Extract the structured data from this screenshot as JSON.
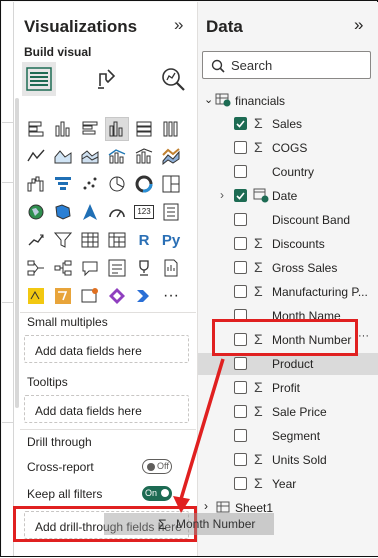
{
  "visualizations": {
    "title": "Visualizations",
    "collapse_icon": "»",
    "build_visual_label": "Build visual",
    "sections": {
      "small_multiples": "Small multiples",
      "tooltips": "Tooltips",
      "drill_through": "Drill through"
    },
    "wells": {
      "small_multiples_placeholder": "Add data fields here",
      "tooltips_placeholder": "Add data fields here",
      "drill_through_placeholder": "Add drill-through fields here"
    },
    "cross_report": {
      "label": "Cross-report",
      "state": "Off"
    },
    "keep_all_filters": {
      "label": "Keep all filters",
      "state": "On"
    },
    "more_icon": "···",
    "r_label": "R",
    "py_label": "Py",
    "kpi_label": "123"
  },
  "data": {
    "title": "Data",
    "collapse_icon": "»",
    "search_placeholder": "Search",
    "table_financials": "financials",
    "table_sheet1": "Sheet1",
    "fields": [
      {
        "name": "Sales",
        "sigma": true,
        "checked": true
      },
      {
        "name": "COGS",
        "sigma": true,
        "checked": false
      },
      {
        "name": "Country",
        "sigma": false,
        "checked": false
      },
      {
        "name": "Date",
        "sigma": false,
        "checked": true,
        "hierarchy": true
      },
      {
        "name": "Discount Band",
        "sigma": false,
        "checked": false
      },
      {
        "name": "Discounts",
        "sigma": true,
        "checked": false
      },
      {
        "name": "Gross Sales",
        "sigma": true,
        "checked": false
      },
      {
        "name": "Manufacturing P...",
        "sigma": true,
        "checked": false
      },
      {
        "name": "Month Name",
        "sigma": false,
        "checked": false
      },
      {
        "name": "Month Number",
        "sigma": true,
        "checked": false
      },
      {
        "name": "Product",
        "sigma": false,
        "checked": false
      },
      {
        "name": "Profit",
        "sigma": true,
        "checked": false
      },
      {
        "name": "Sale Price",
        "sigma": true,
        "checked": false
      },
      {
        "name": "Segment",
        "sigma": false,
        "checked": false
      },
      {
        "name": "Units Sold",
        "sigma": true,
        "checked": false
      },
      {
        "name": "Year",
        "sigma": true,
        "checked": false
      }
    ],
    "ellipsis": "···"
  },
  "drag_ghost": {
    "sigma": "Σ",
    "label": "Month Number"
  },
  "colors": {
    "accent": "#1d6b53",
    "highlight": "#e02020"
  }
}
